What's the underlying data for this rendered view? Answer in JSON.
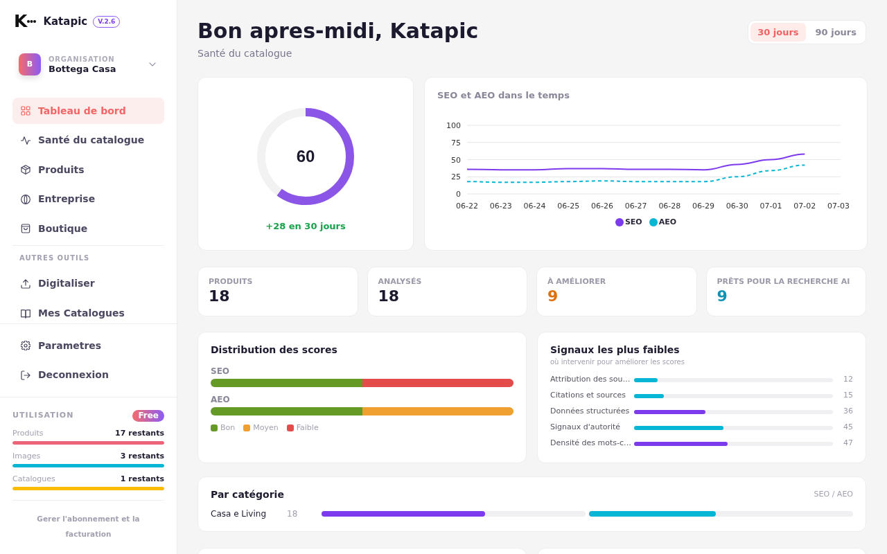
{
  "sidebar": {
    "brand": {
      "mark": "K",
      "name": "Katapic",
      "version": "V.2.6"
    },
    "organization": {
      "label": "ORGANISATION",
      "initial": "B",
      "name": "Bottega Casa"
    },
    "nav": [
      {
        "label": "Tableau de bord",
        "selected": true
      },
      {
        "label": "Santé du catalogue",
        "selected": false
      },
      {
        "label": "Produits",
        "selected": false
      },
      {
        "label": "Entreprise",
        "selected": false
      },
      {
        "label": "Boutique",
        "selected": false
      }
    ],
    "tools": {
      "title": "AUTRES OUTILS",
      "items": [
        {
          "label": "Digitaliser",
          "selected": false
        },
        {
          "label": "Mes Catalogues",
          "selected": false
        }
      ]
    },
    "footer_nav": [
      {
        "label": "Parametres",
        "selected": false
      },
      {
        "label": "Deconnexion",
        "selected": false
      }
    ],
    "usage": {
      "title": "UTILISATION",
      "plan": "Free",
      "items": [
        {
          "label": "Produits",
          "remaining": "17 restants",
          "level": 1,
          "color": "#ec6478"
        },
        {
          "label": "Images",
          "remaining": "3 restants",
          "level": 1,
          "color": "#06b6d4"
        },
        {
          "label": "Catalogues",
          "remaining": "1 restants",
          "level": 1,
          "color": "#fbbc05"
        }
      ],
      "link": "Gerer l'abonnement et la facturation"
    }
  },
  "header": {
    "title": "Bon apres-midi, Katapic",
    "subtitle": "Santé du catalogue",
    "periods": [
      {
        "label": "30 jours",
        "selected": true
      },
      {
        "label": "90 jours",
        "selected": false
      }
    ]
  },
  "score": {
    "value": "60",
    "level": 0.6,
    "delta": "+28 en 30 jours"
  },
  "trend": {
    "chart_data": {
      "type": "line",
      "title": "SEO et AEO dans le temps",
      "categories": [
        "06-22",
        "06-23",
        "06-24",
        "06-25",
        "06-26",
        "06-27",
        "06-28",
        "06-29",
        "06-30",
        "07-01",
        "07-02",
        "07-03"
      ],
      "ylim": [
        0,
        100
      ],
      "yticks": [
        0,
        25,
        50,
        75,
        100
      ],
      "grid": true,
      "legend": "bottom",
      "series": [
        {
          "name": "SEO",
          "color": "#7c3aed",
          "line_style": "solid",
          "values": [
            36,
            35,
            35,
            37,
            37,
            36,
            36,
            35,
            43,
            50,
            58,
            null
          ]
        },
        {
          "name": "AEO",
          "color": "#06b6d4",
          "line_style": "dashed",
          "values": [
            18,
            17,
            17,
            18,
            19,
            18,
            18,
            18,
            25,
            34,
            42,
            null
          ]
        }
      ]
    }
  },
  "stats": [
    {
      "label": "PRODUITS",
      "value": "18",
      "color": "#1c1a2e"
    },
    {
      "label": "ANALYSÉS",
      "value": "18",
      "color": "#1c1a2e"
    },
    {
      "label": "À AMÉLIORER",
      "value": "9",
      "color": "#e07008"
    },
    {
      "label": "PRÊTS POUR LA RECHERCHE AI",
      "value": "9",
      "color": "#0e93b5"
    }
  ],
  "distribution": {
    "title": "Distribution des scores",
    "rows": [
      {
        "label": "SEO",
        "segments": [
          {
            "level": 0.5,
            "color": "#659a26"
          },
          {
            "level": 0.5,
            "color": "#e44b4b"
          }
        ]
      },
      {
        "label": "AEO",
        "segments": [
          {
            "level": 0.5,
            "color": "#659a26"
          },
          {
            "level": 0.5,
            "color": "#f0a030"
          }
        ]
      }
    ],
    "legend": [
      {
        "label": "Bon",
        "color": "#659a26"
      },
      {
        "label": "Moyen",
        "color": "#f0a030"
      },
      {
        "label": "Faible",
        "color": "#e44b4b"
      }
    ]
  },
  "signals": {
    "title": "Signaux les plus faibles",
    "subtitle": "où intervenir pour améliorer les scores",
    "items": [
      {
        "label": "Attribution des sou…",
        "level": 0.12,
        "value": "12",
        "color": "#06b6d4"
      },
      {
        "label": "Citations et sources",
        "level": 0.15,
        "value": "15",
        "color": "#06b6d4"
      },
      {
        "label": "Données structurées",
        "level": 0.36,
        "value": "36",
        "color": "#7c3aed"
      },
      {
        "label": "Signaux d'autorité",
        "level": 0.45,
        "value": "45",
        "color": "#06b6d4"
      },
      {
        "label": "Densité des mots-c…",
        "level": 0.47,
        "value": "47",
        "color": "#7c3aed"
      }
    ]
  },
  "categories": {
    "title": "Par catégorie",
    "legend": "SEO / AEO",
    "rows": [
      {
        "name": "Casa e Living",
        "count": "18",
        "bars": [
          {
            "level": 0.62,
            "color": "#7c3aed"
          },
          {
            "level": 0.48,
            "color": "#06b6d4"
          }
        ]
      }
    ]
  }
}
